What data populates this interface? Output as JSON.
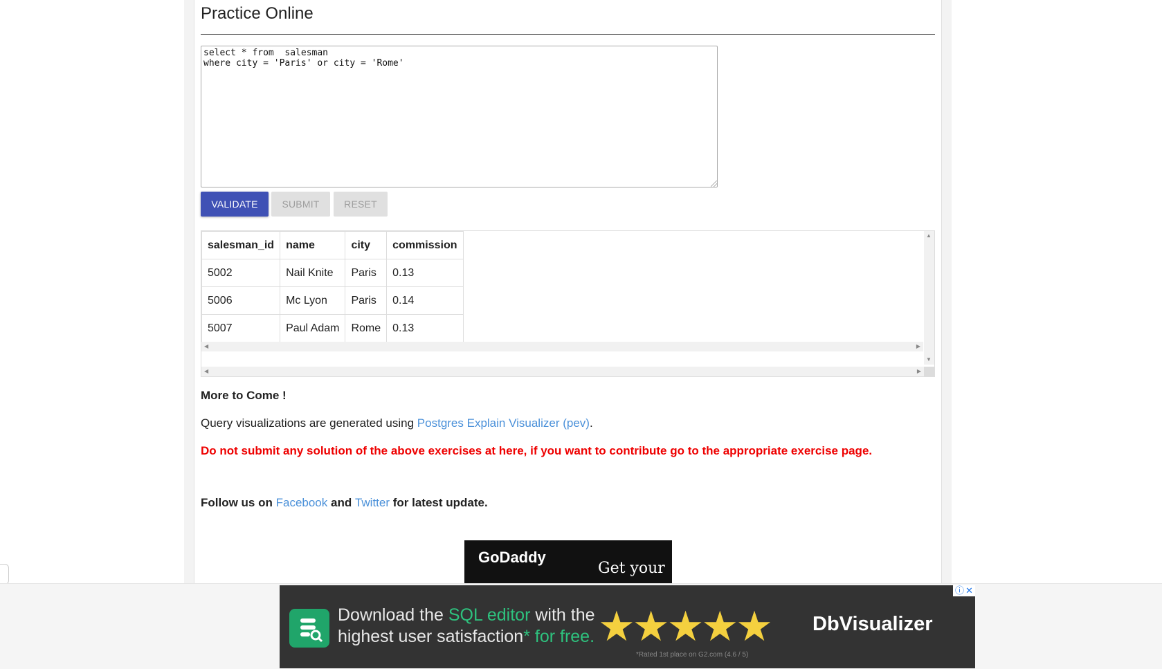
{
  "title": "Practice Online",
  "editor": {
    "sql": "select * from  salesman\nwhere city = 'Paris' or city = 'Rome'"
  },
  "buttons": {
    "validate": "VALIDATE",
    "submit": "SUBMIT",
    "reset": "RESET"
  },
  "result": {
    "columns": [
      "salesman_id",
      "name",
      "city",
      "commission"
    ],
    "rows": [
      [
        "5002",
        "Nail Knite",
        "Paris",
        "0.13"
      ],
      [
        "5006",
        "Mc Lyon",
        "Paris",
        "0.14"
      ],
      [
        "5007",
        "Paul Adam",
        "Rome",
        "0.13"
      ]
    ]
  },
  "info": {
    "more": "More to Come !",
    "qv_prefix": "Query visualizations are generated using ",
    "qv_link": "Postgres Explain Visualizer (pev)",
    "qv_suffix": ".",
    "warning": "Do not submit any solution of the above exercises at here, if you want to contribute go to the appropriate exercise page.",
    "follow_prefix": "Follow us on ",
    "facebook": "Facebook",
    "follow_and": " and ",
    "twitter": "Twitter",
    "follow_suffix": " for latest update."
  },
  "ad_godaddy": {
    "logo": "GoDaddy",
    "tagline": "Get your"
  },
  "ad_dbvis": {
    "line1_a": "Download the ",
    "line1_hl": "SQL editor",
    "line1_b": " with the",
    "line2_a": "highest user satisfaction",
    "line2_star": "*",
    "line2_hl": " for free.",
    "stars": "★★★★★",
    "brand": "DbVisualizer",
    "note": "*Rated 1st place on G2.com (4.6 / 5)"
  },
  "colors": {
    "primary_button": "#3f51b5",
    "link": "#4a90d9",
    "warning": "#ee0000",
    "ad_accent": "#2ec27e"
  }
}
